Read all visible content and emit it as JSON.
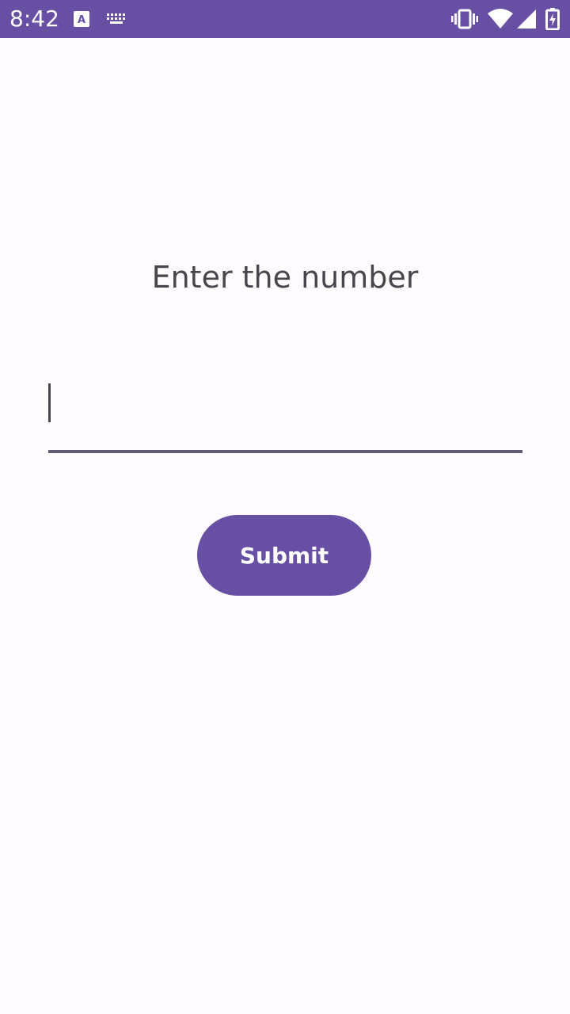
{
  "status_bar": {
    "time": "8:42",
    "background_color": "#6750a4",
    "left_icons": [
      "font-a-icon",
      "keyboard-icon"
    ],
    "right_icons": [
      "vibrate-icon",
      "wifi-icon",
      "cell-signal-icon",
      "battery-charging-icon"
    ]
  },
  "main": {
    "prompt": "Enter the number",
    "input": {
      "value": "",
      "placeholder": ""
    },
    "submit_label": "Submit"
  },
  "colors": {
    "accent": "#6750a4",
    "background": "#fffbfe",
    "text": "#49454f",
    "underline": "#625b71"
  }
}
